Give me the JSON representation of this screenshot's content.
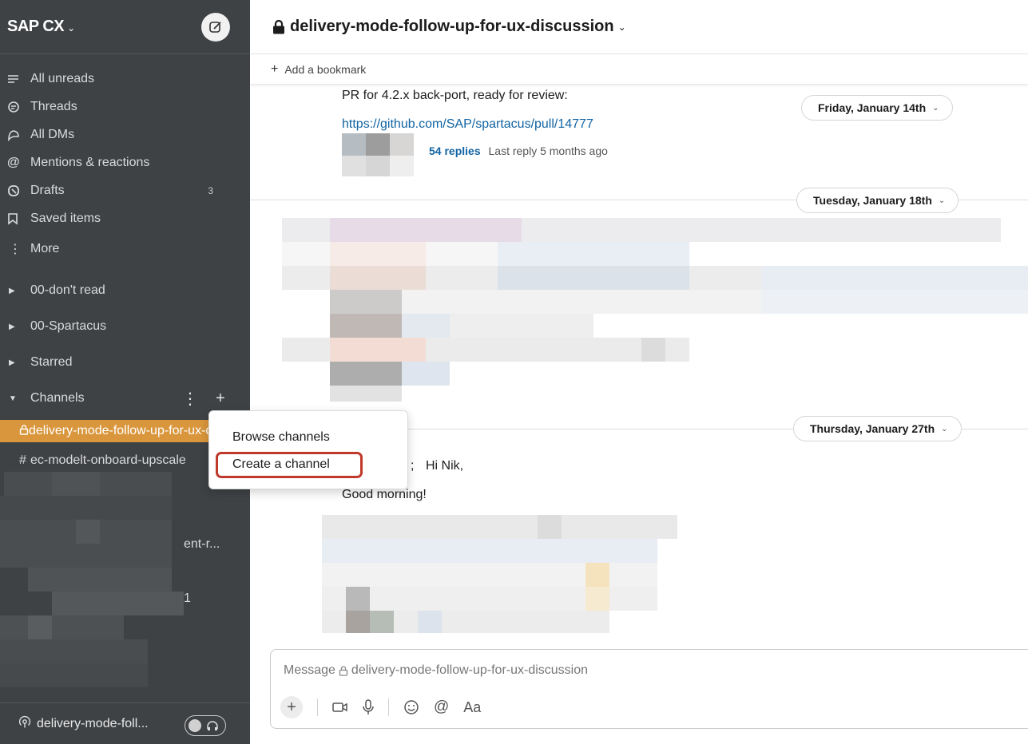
{
  "workspace": {
    "name": "SAP CX"
  },
  "nav": [
    {
      "label": "All unreads",
      "icon": "list-icon"
    },
    {
      "label": "Threads",
      "icon": "threads-icon"
    },
    {
      "label": "All DMs",
      "icon": "dms-icon"
    },
    {
      "label": "Mentions & reactions",
      "icon": "at-icon"
    },
    {
      "label": "Drafts",
      "icon": "drafts-icon",
      "badge": "3"
    },
    {
      "label": "Saved items",
      "icon": "bookmark-icon"
    },
    {
      "label": "More",
      "icon": "more-icon"
    }
  ],
  "sections": [
    {
      "label": "00-don't read"
    },
    {
      "label": "00-Spartacus"
    },
    {
      "label": "Starred"
    },
    {
      "label": "Channels"
    }
  ],
  "channels": [
    {
      "label": "delivery-mode-follow-up-for-ux-discussion",
      "prefix": "🔒"
    },
    {
      "label": "ec-modelt-onboard-upscale",
      "prefix": "#"
    }
  ],
  "sidebar_blur": {
    "text1": "ent-r...",
    "text2": "1"
  },
  "footer": {
    "label": "delivery-mode-foll..."
  },
  "header": {
    "channel": "delivery-mode-follow-up-for-ux-discussion",
    "bookmark": "Add a bookmark"
  },
  "messages": {
    "m1_text": "PR for 4.2.x back-port, ready for review:",
    "m1_link": "https://github.com/SAP/spartacus/pull/14777",
    "replies_count": "54 replies",
    "replies_last": "Last reply 5 months ago",
    "m3_greeting": "Hi Nik,",
    "m3_mention_tail": ";",
    "m3_line2": "Good morning!"
  },
  "dates": {
    "d1": "Friday, January 14th",
    "d2": "Tuesday, January 18th",
    "d3": "Thursday, January 27th"
  },
  "composer": {
    "placeholder": "Message",
    "channel": "delivery-mode-follow-up-for-ux-discussion",
    "format_label": "Aa"
  },
  "menu": {
    "items": [
      "Browse channels",
      "Create a channel"
    ]
  },
  "colors": {
    "sidebar": "#3f4245",
    "active_channel": "#d9963c",
    "link": "#1264a3",
    "highlight": "#c0392b"
  }
}
